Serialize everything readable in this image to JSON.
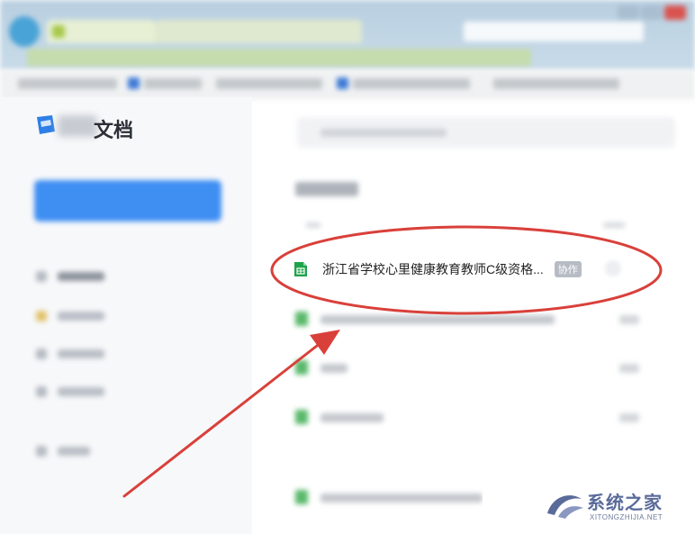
{
  "app": {
    "logo_text": "文档"
  },
  "document": {
    "title": "浙江省学校心里健康教育教师C级资格...",
    "badge": "协作"
  },
  "annotation": {
    "highlight_color": "#d9403a",
    "arrow_color": "#d9403a"
  },
  "watermark": {
    "text": "系统之家",
    "subtext": "XITONGZHIJIA.NET"
  },
  "colors": {
    "accent_blue": "#3f8ef2",
    "sheet_green": "#1fa34a"
  }
}
